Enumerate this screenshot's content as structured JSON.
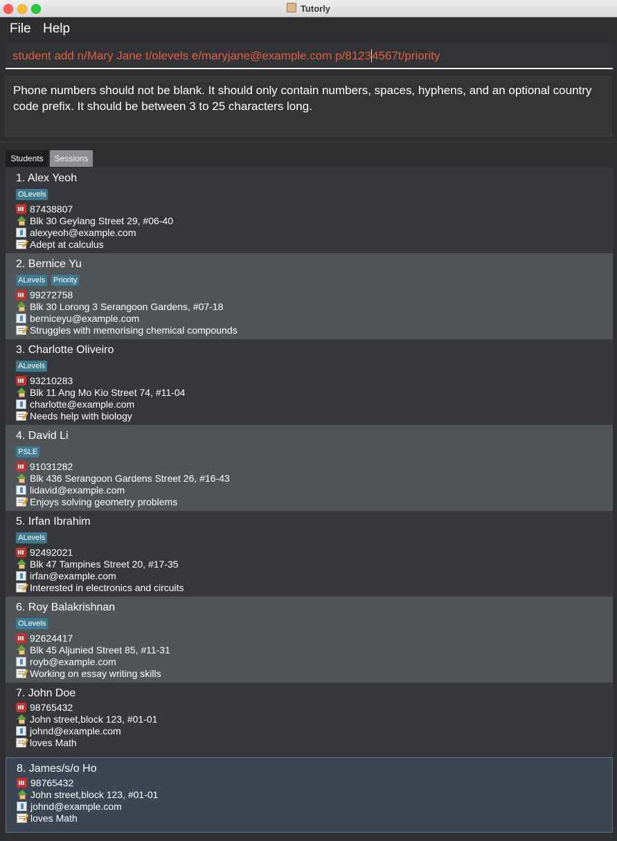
{
  "window": {
    "title": "Tutorly"
  },
  "menu": {
    "file": "File",
    "help": "Help"
  },
  "command": {
    "before_caret": "student add n/Mary Jane t/olevels e/maryjane@example.com p/8123",
    "after_caret": "4567t/priority"
  },
  "result": {
    "message": "Phone numbers should not be blank. It should only contain numbers, spaces, hyphens, and an optional country code prefix. It should be between 3 to 25 characters long."
  },
  "tabs": {
    "students": "Students",
    "sessions": "Sessions"
  },
  "students": [
    {
      "name": "1. Alex Yeoh",
      "tags": [
        "OLevels"
      ],
      "phone": "87438807",
      "address": "Blk 30 Geylang Street 29, #06-40",
      "email": "alexyeoh@example.com",
      "note": "Adept at calculus"
    },
    {
      "name": "2. Bernice Yu",
      "tags": [
        "ALevels",
        "Priority"
      ],
      "phone": "99272758",
      "address": "Blk 30 Lorong 3 Serangoon Gardens, #07-18",
      "email": "berniceyu@example.com",
      "note": "Struggles with memorising chemical compounds"
    },
    {
      "name": "3. Charlotte Oliveiro",
      "tags": [
        "ALevels"
      ],
      "phone": "93210283",
      "address": "Blk 11 Ang Mo Kio Street 74, #11-04",
      "email": "charlotte@example.com",
      "note": "Needs help with biology"
    },
    {
      "name": "4. David Li",
      "tags": [
        "PSLE"
      ],
      "phone": "91031282",
      "address": "Blk 436 Serangoon Gardens Street 26, #16-43",
      "email": "lidavid@example.com",
      "note": "Enjoys solving geometry problems"
    },
    {
      "name": "5. Irfan Ibrahim",
      "tags": [
        "ALevels"
      ],
      "phone": "92492021",
      "address": "Blk 47 Tampines Street 20, #17-35",
      "email": "irfan@example.com",
      "note": "Interested in electronics and circuits"
    },
    {
      "name": "6. Roy Balakrishnan",
      "tags": [
        "OLevels"
      ],
      "phone": "92624417",
      "address": "Blk 45 Aljunied Street 85, #11-31",
      "email": "royb@example.com",
      "note": "Working on essay writing skills"
    },
    {
      "name": "7. John Doe",
      "tags": [],
      "phone": "98765432",
      "address": "John street,block 123, #01-01",
      "email": "johnd@example.com",
      "note": "loves Math"
    },
    {
      "name": "8. James/s/o Ho",
      "tags": [],
      "phone": "98765432",
      "address": "John street,block 123, #01-01",
      "email": "johnd@example.com",
      "note": "loves Math"
    }
  ]
}
